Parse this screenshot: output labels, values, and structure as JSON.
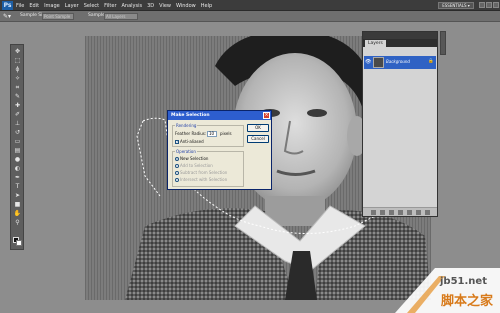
{
  "app": {
    "logo": "Ps",
    "workspace": "ESSENTIALS ▾"
  },
  "menu": [
    "File",
    "Edit",
    "Image",
    "Layer",
    "Select",
    "Filter",
    "Analysis",
    "3D",
    "View",
    "Window",
    "Help"
  ],
  "options": {
    "sample_size_label": "Sample Size:",
    "sample_size_value": "Point Sample",
    "sample_label": "Sample:",
    "sample_value": "All Layers"
  },
  "layers": {
    "tab": "Layers",
    "layer_name": "Background"
  },
  "dialog": {
    "title": "Make Selection",
    "rendering_legend": "Rendering",
    "feather_label": "Feather Radius:",
    "feather_value": "10",
    "feather_unit": "pixels",
    "anti_aliased": "Anti-aliased",
    "anti_aliased_checked": true,
    "operation_legend": "Operation",
    "operations": [
      "New Selection",
      "Add to Selection",
      "Subtract from Selection",
      "Intersect with Selection"
    ],
    "selected_operation": "New Selection",
    "ok": "OK",
    "cancel": "Cancel"
  },
  "watermark": {
    "url": "jb51.net",
    "cn": "脚本之家"
  },
  "colors": {
    "foreground": "#111111",
    "background": "#ffffff",
    "dialog_title": "#2d5ecf",
    "layer_selected": "#2f62c4",
    "watermark_orange": "#d87a1a"
  }
}
